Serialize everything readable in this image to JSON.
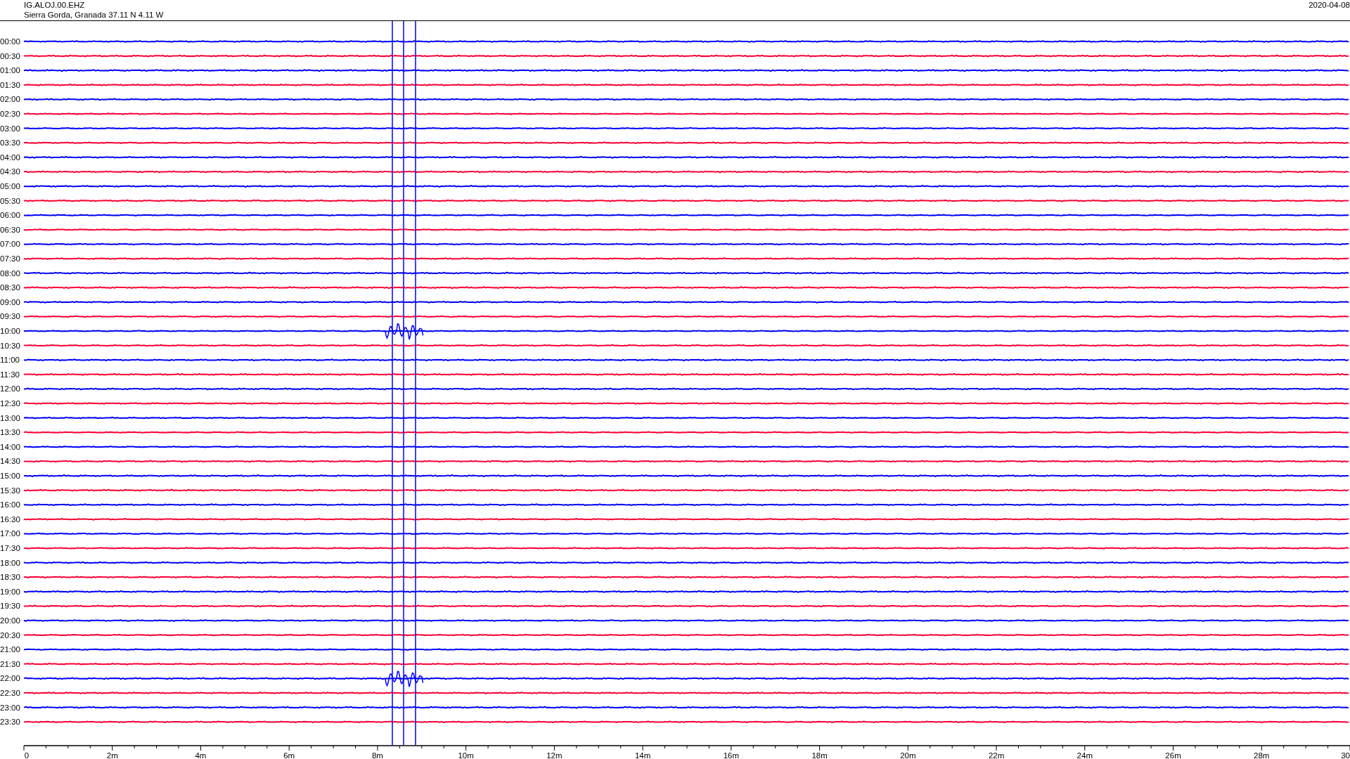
{
  "header": {
    "station": "IG.ALOJ.00.EHZ",
    "location": "Sierra Gorda, Granada  37.11 N 4.11 W",
    "date": "2020-04-08"
  },
  "helicorder": {
    "rows": [
      {
        "time": "00:00",
        "color": "#0000ff"
      },
      {
        "time": "00:30",
        "color": "#ff0033"
      },
      {
        "time": "01:00",
        "color": "#0000ff"
      },
      {
        "time": "01:30",
        "color": "#ff0033"
      },
      {
        "time": "02:00",
        "color": "#0000ff"
      },
      {
        "time": "02:30",
        "color": "#ff0033"
      },
      {
        "time": "03:00",
        "color": "#0000ff"
      },
      {
        "time": "03:30",
        "color": "#ff0033"
      },
      {
        "time": "04:00",
        "color": "#0000ff"
      },
      {
        "time": "04:30",
        "color": "#ff0033"
      },
      {
        "time": "05:00",
        "color": "#0000ff"
      },
      {
        "time": "05:30",
        "color": "#ff0033"
      },
      {
        "time": "06:00",
        "color": "#0000ff"
      },
      {
        "time": "06:30",
        "color": "#ff0033"
      },
      {
        "time": "07:00",
        "color": "#0000ff"
      },
      {
        "time": "07:30",
        "color": "#ff0033"
      },
      {
        "time": "08:00",
        "color": "#0000ff"
      },
      {
        "time": "08:30",
        "color": "#ff0033"
      },
      {
        "time": "09:00",
        "color": "#0000ff"
      },
      {
        "time": "09:30",
        "color": "#ff0033"
      },
      {
        "time": "10:00",
        "color": "#0000ff"
      },
      {
        "time": "10:30",
        "color": "#ff0033"
      },
      {
        "time": "11:00",
        "color": "#0000ff"
      },
      {
        "time": "11:30",
        "color": "#ff0033"
      },
      {
        "time": "12:00",
        "color": "#0000ff"
      },
      {
        "time": "12:30",
        "color": "#ff0033"
      },
      {
        "time": "13:00",
        "color": "#0000ff"
      },
      {
        "time": "13:30",
        "color": "#ff0033"
      },
      {
        "time": "14:00",
        "color": "#0000ff"
      },
      {
        "time": "14:30",
        "color": "#ff0033"
      },
      {
        "time": "15:00",
        "color": "#0000ff"
      },
      {
        "time": "15:30",
        "color": "#ff0033"
      },
      {
        "time": "16:00",
        "color": "#0000ff"
      },
      {
        "time": "16:30",
        "color": "#ff0033"
      },
      {
        "time": "17:00",
        "color": "#0000ff"
      },
      {
        "time": "17:30",
        "color": "#ff0033"
      },
      {
        "time": "18:00",
        "color": "#0000ff"
      },
      {
        "time": "18:30",
        "color": "#ff0033"
      },
      {
        "time": "19:00",
        "color": "#0000ff"
      },
      {
        "time": "19:30",
        "color": "#ff0033"
      },
      {
        "time": "20:00",
        "color": "#0000ff"
      },
      {
        "time": "20:30",
        "color": "#ff0033"
      },
      {
        "time": "21:00",
        "color": "#0000ff"
      },
      {
        "time": "21:30",
        "color": "#ff0033"
      },
      {
        "time": "22:00",
        "color": "#0000ff"
      },
      {
        "time": "22:30",
        "color": "#ff0033"
      },
      {
        "time": "23:00",
        "color": "#0000ff"
      },
      {
        "time": "23:30",
        "color": "#ff0033"
      }
    ],
    "x_ticks": [
      "0",
      "2m",
      "4m",
      "6m",
      "8m",
      "10m",
      "12m",
      "14m",
      "16m",
      "18m",
      "20m",
      "22m",
      "24m",
      "26m",
      "28m",
      "30"
    ]
  }
}
